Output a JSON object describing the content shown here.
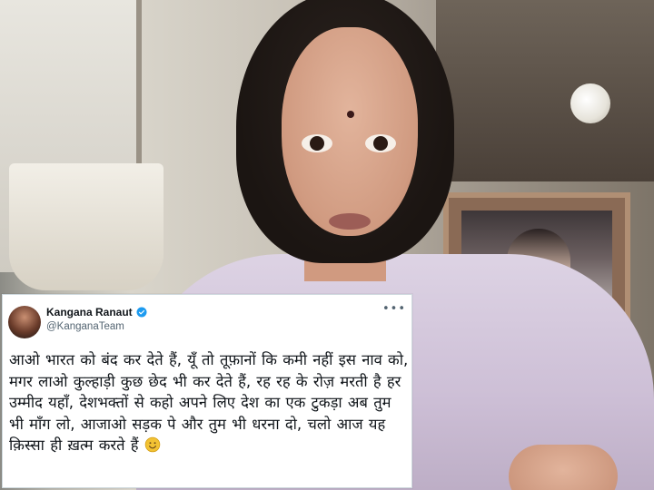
{
  "tweet": {
    "author_name": "Kangana Ranaut",
    "handle": "@KanganaTeam",
    "more_icon": "more-horizontal-icon",
    "verified_icon": "verified-badge-icon",
    "text": "आओ भारत को बंद कर देते हैं, यूँ तो तूफ़ानों कि कमी नहीं इस नाव को, मगर लाओ कुल्हाड़ी कुछ छेद भी कर देते हैं, रह रह के रोज़ मरती है हर उम्मीद यहाँ, देशभक्तों से कहो अपने लिए देश का एक टुकड़ा अब तुम भी माँग लो, आजाओ सड़क पे और तुम भी धरना दो, चलो आज यह क़िस्सा ही ख़त्म करते हैं",
    "emoji_icon": "slightly-smiling-face-icon"
  },
  "colors": {
    "verified": "#1d9bf0",
    "text": "#0f1419",
    "muted": "#536471",
    "emoji": "#f2c233"
  }
}
